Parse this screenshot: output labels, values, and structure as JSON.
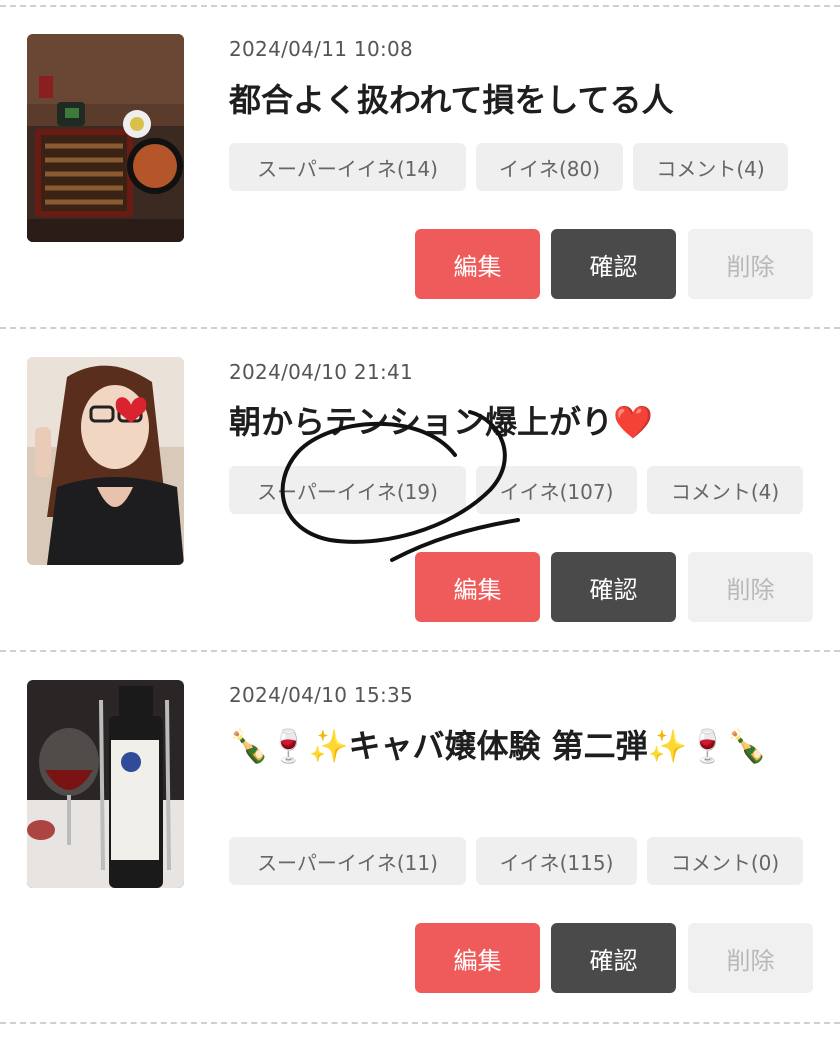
{
  "posts": [
    {
      "date": "2024/04/11 10:08",
      "title": "都合よく扱われて損をしてる人",
      "super_like": "スーパーイイネ(14)",
      "like": "イイネ(80)",
      "comment": "コメント(4)",
      "edit": "編集",
      "confirm": "確認",
      "delete": "削除",
      "thumb_alt": "unagi-jyu-photo"
    },
    {
      "date": "2024/04/10 21:41",
      "title": "朝からテンション爆上がり❤️",
      "super_like": "スーパーイイネ(19)",
      "like": "イイネ(107)",
      "comment": "コメント(4)",
      "edit": "編集",
      "confirm": "確認",
      "delete": "削除",
      "thumb_alt": "selfie-photo"
    },
    {
      "date": "2024/04/10 15:35",
      "title": "🍾🍷✨キャバ嬢体験 第二弾✨🍷🍾",
      "super_like": "スーパーイイネ(11)",
      "like": "イイネ(115)",
      "comment": "コメント(0)",
      "edit": "編集",
      "confirm": "確認",
      "delete": "削除",
      "thumb_alt": "wine-photo"
    }
  ],
  "colors": {
    "edit": "#ef5b5b",
    "confirm": "#4a4a4a",
    "delete_bg": "#f0f0f0",
    "chip_bg": "#efefef"
  }
}
